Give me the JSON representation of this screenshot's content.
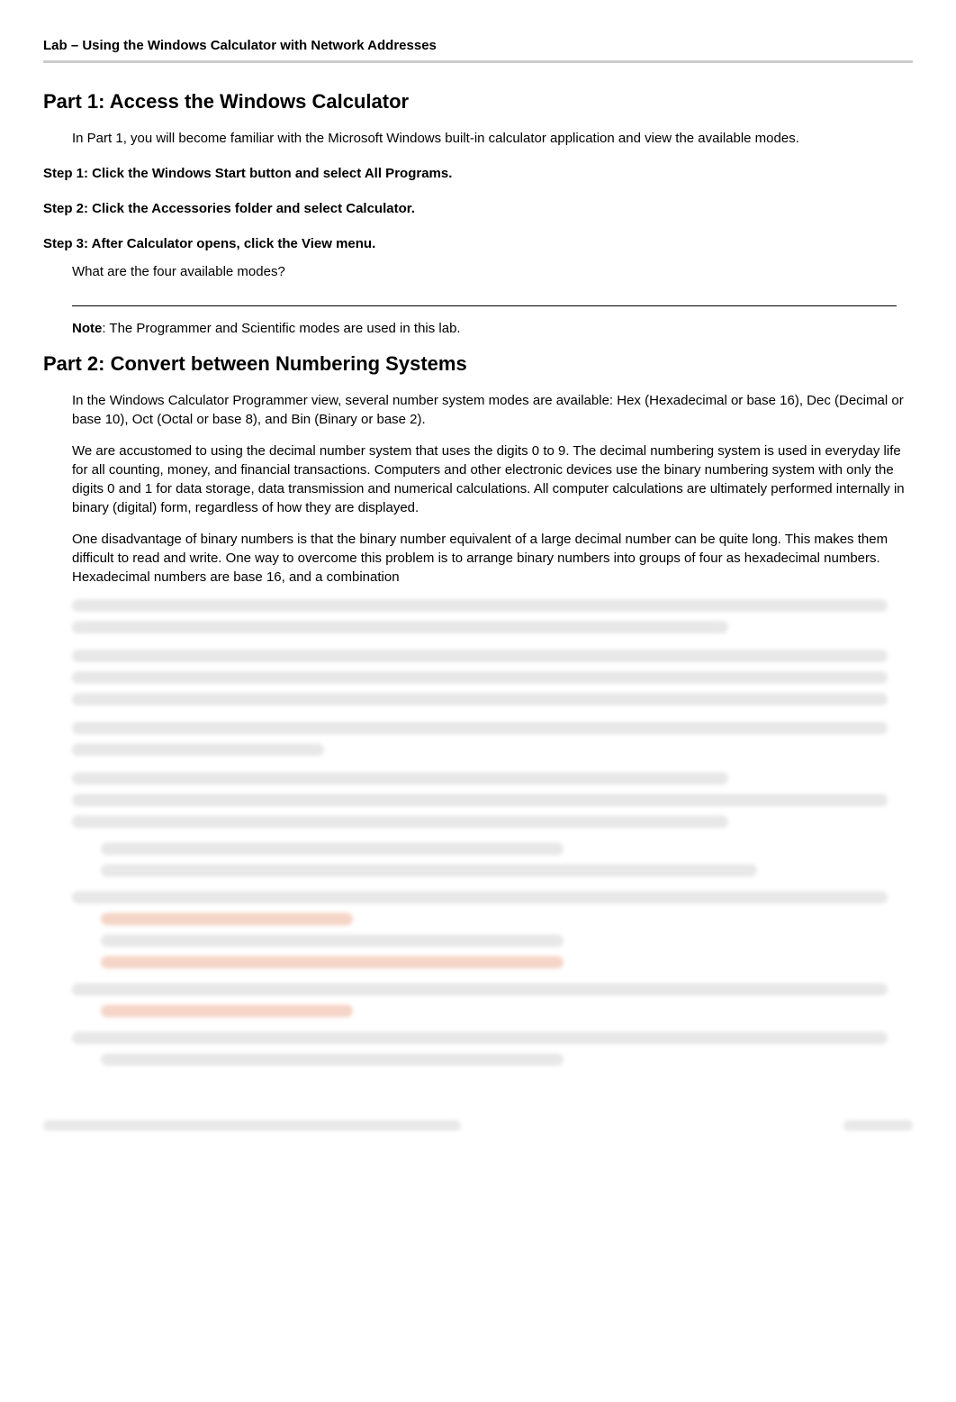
{
  "header": {
    "doc_title": "Lab – Using the Windows Calculator with Network Addresses"
  },
  "part1": {
    "heading": "Part 1:   Access the Windows Calculator",
    "intro": "In Part 1, you will become familiar with the Microsoft Windows built-in calculator application and view the available modes.",
    "step1": "Step 1:   Click the Windows Start button and select All Programs.",
    "step2": "Step 2:   Click the Accessories folder and select Calculator.",
    "step3": "Step 3:   After Calculator opens, click the View menu.",
    "question": "What are the four available modes?",
    "note_label": "Note",
    "note_text": ": The Programmer and Scientific modes are used in this lab."
  },
  "part2": {
    "heading": "Part 2:   Convert between Numbering Systems",
    "p1": "In the Windows Calculator Programmer view, several number system modes are available: Hex (Hexadecimal or base 16), Dec (Decimal or base 10), Oct (Octal or base 8), and Bin (Binary or base 2).",
    "p2": "We are accustomed to using the decimal number system that uses the digits 0 to 9. The decimal numbering system is used in everyday life for all counting, money, and financial transactions. Computers and other electronic devices use the binary numbering system with only the digits 0 and 1 for data storage, data transmission and numerical calculations. All computer calculations are ultimately performed internally in binary (digital) form, regardless of how they are displayed.",
    "p3": "One disadvantage of binary numbers is that the binary number equivalent of a large decimal number can be quite long. This makes them difficult to read and write. One way to overcome this problem is to arrange binary numbers into groups of four as hexadecimal numbers. Hexadecimal numbers are base 16, and a combination"
  }
}
